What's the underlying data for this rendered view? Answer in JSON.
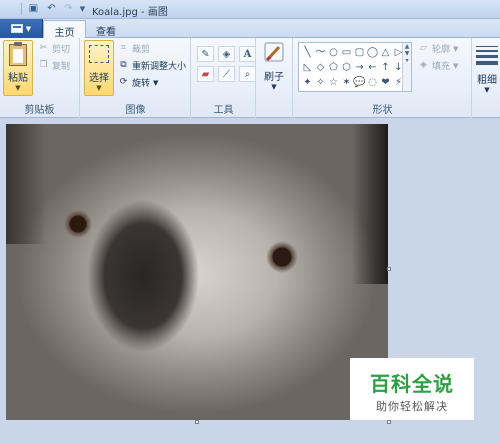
{
  "window": {
    "title": "Koala.jpg - 画图"
  },
  "tabs": {
    "home": "主页",
    "view": "查看"
  },
  "clipboard": {
    "paste": "粘贴",
    "cut": "剪切",
    "copy": "复制",
    "label": "剪贴板"
  },
  "image": {
    "select": "选择",
    "crop": "裁剪",
    "resize": "重新调整大小",
    "rotate": "旋转",
    "label": "图像"
  },
  "tools": {
    "label": "工具"
  },
  "brushes": {
    "label": "刷子"
  },
  "shapes": {
    "label": "形状",
    "outline": "轮廓",
    "fill": "填充",
    "items": [
      "╲",
      "〜",
      "○",
      "▭",
      "▢",
      "◯",
      "△",
      "▷",
      "◺",
      "◇",
      "⬠",
      "⬡",
      "→",
      "←",
      "↑",
      "↓",
      "✦",
      "✧",
      "☆",
      "✶",
      "💬",
      "◌",
      "❤",
      "⚡"
    ]
  },
  "colors": {
    "label": "粗细"
  },
  "watermark": {
    "title": "百科全说",
    "subtitle": "助你轻松解决"
  }
}
